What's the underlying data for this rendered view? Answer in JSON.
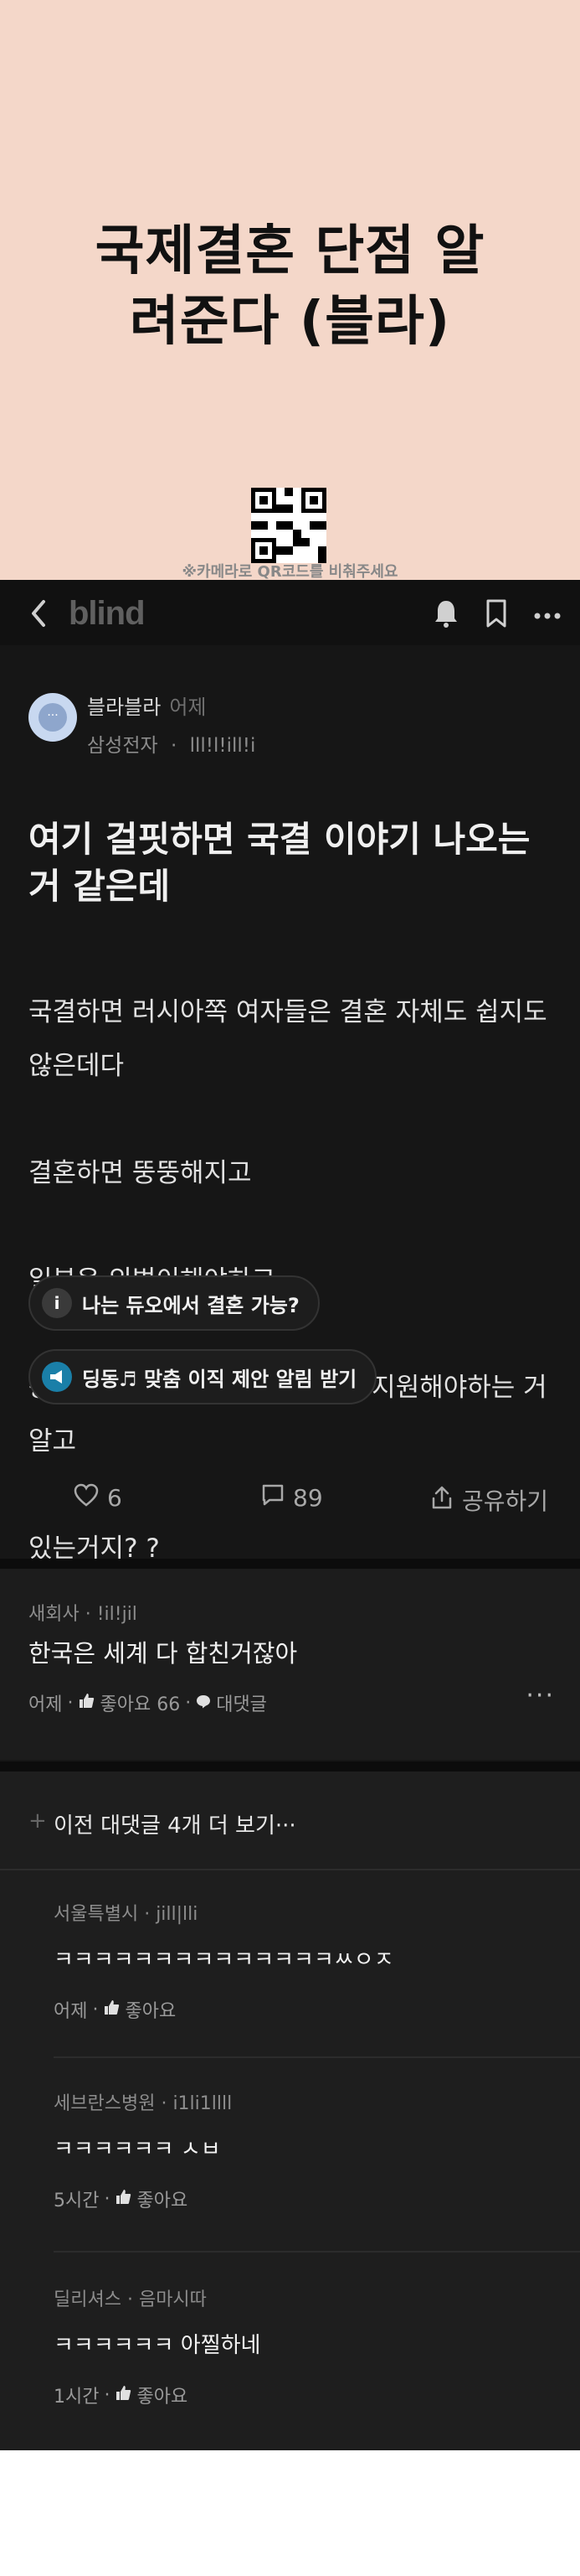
{
  "banner": {
    "title_line1": "국제결혼 단점 알",
    "title_line2": "려준다 (블라)",
    "qr_caption": "※카메라로 QR코드를 비춰주세요"
  },
  "topbar": {
    "back_icon": "chevron-left-icon",
    "logo": "blind",
    "icons": [
      "bell-icon",
      "bookmark-icon",
      "more-icon"
    ]
  },
  "post": {
    "author": "블라블라",
    "time": "어제",
    "company": "삼성전자",
    "company_suffix": "lll!l!ill!i",
    "title": "여기 걸핏하면 국결 이야기 나오는거 같은데",
    "body_lines": [
      "국결하면 러시아쪽 여자들은 결혼 자체도 쉽지도 않은데다",
      "결혼하면 뚱뚱해지고",
      "일본은 외벌이해야하고",
      "동남아는 여자 부모님께 생활비 지원해야하는 거 알고",
      "있는거지? ?"
    ]
  },
  "chips": [
    {
      "label": "나는 듀오에서 결혼 가능?",
      "icon": "info-icon",
      "color": "#3a3a3a"
    },
    {
      "label": "딩동♬ 맞춤 이직 제안 알림 받기",
      "icon": "megaphone-icon",
      "color": "#1a7fa8"
    }
  ],
  "actions": {
    "likes": "6",
    "comments": "89",
    "share": "공유하기"
  },
  "comments": [
    {
      "company": "새회사",
      "user": "!il!jil",
      "text": "한국은 세계 다 합친거잖아",
      "time": "어제",
      "like_label": "좋아요 66",
      "reply_label": "대댓글"
    }
  ],
  "more_replies": "이전 대댓글 4개 더 보기···",
  "replies": [
    {
      "company": "서울특별시",
      "user": "jill|lli",
      "text": "ㅋㅋㅋㅋㅋㅋㅋㅋㅋㅋㅋㅋㅋㅋㅆㅇㅈ",
      "time": "어제",
      "like_label": "좋아요"
    },
    {
      "company": "세브란스병원",
      "user": "i1li1llll",
      "text": "ㅋㅋㅋㅋㅋㅋ ㅅㅂ",
      "time": "5시간",
      "like_label": "좋아요"
    },
    {
      "company": "딜리셔스",
      "user": "음마시따",
      "text": "ㅋㅋㅋㅋㅋㅋ 아찔하네",
      "time": "1시간",
      "like_label": "좋아요"
    }
  ]
}
